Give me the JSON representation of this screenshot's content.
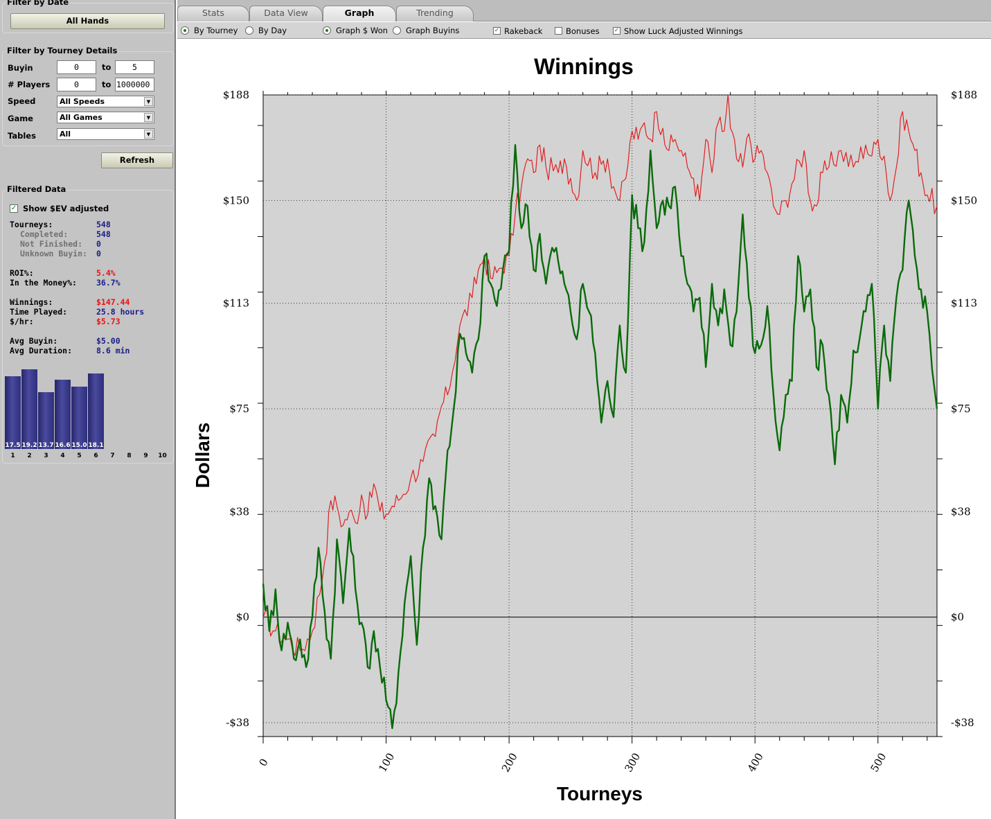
{
  "sidebar": {
    "filter_by_date": {
      "title": "Filter by Date",
      "all_hands": "All Hands"
    },
    "filter_tourney": {
      "title": "Filter by Tourney Details",
      "buyin_label": "Buyin",
      "buyin_from": "0",
      "buyin_to": "5",
      "players_label": "# Players",
      "players_from": "0",
      "players_to": "1000000",
      "to": "to",
      "speed_label": "Speed",
      "speed_value": "All Speeds",
      "game_label": "Game",
      "game_value": "All Games",
      "tables_label": "Tables",
      "tables_value": "All",
      "refresh": "Refresh"
    },
    "filtered": {
      "title": "Filtered Data",
      "show_ev": "Show $EV adjusted",
      "tourneys_label": "Tourneys:",
      "tourneys": "548",
      "completed_label": "Completed:",
      "completed": "548",
      "not_finished_label": "Not Finished:",
      "not_finished": "0",
      "unknown_label": "Unknown Buyin:",
      "unknown": "0",
      "roi_label": "ROI%:",
      "roi": "5.4%",
      "itm_label": "In the Money%:",
      "itm": "36.7%",
      "winnings_label": "Winnings:",
      "winnings": "$147.44",
      "time_label": "Time Played:",
      "time": "25.8 hours",
      "hr_label": "$/hr:",
      "hr": "$5.73",
      "avg_buyin_label": "Avg Buyin:",
      "avg_buyin": "$5.00",
      "avg_dur_label": "Avg Duration:",
      "avg_dur": "8.6 min"
    },
    "histogram": {
      "positions": [
        "1",
        "2",
        "3",
        "4",
        "5",
        "6",
        "7",
        "8",
        "9",
        "10"
      ],
      "values": [
        17.5,
        19.2,
        13.7,
        16.6,
        15.0,
        18.1,
        null,
        null,
        null,
        null
      ],
      "labels": [
        "17.5",
        "19.2",
        "13.7",
        "16.6",
        "15.0",
        "18.1",
        "",
        "",
        "",
        ""
      ]
    }
  },
  "tabs": [
    {
      "label": "Stats",
      "active": false
    },
    {
      "label": "Data View",
      "active": false
    },
    {
      "label": "Graph",
      "active": true
    },
    {
      "label": "Trending",
      "active": false
    }
  ],
  "options": {
    "by_tourney": "By Tourney",
    "by_day": "By Day",
    "graph_won": "Graph $ Won",
    "graph_buyins": "Graph Buyins",
    "rakeback": "Rakeback",
    "bonuses": "Bonuses",
    "luck": "Show Luck Adjusted Winnings"
  },
  "colors": {
    "red_series": "#e02020",
    "green_series": "#0a6a0a",
    "plot_bg": "#d3d3d3"
  },
  "chart_data": {
    "type": "line",
    "title": "Winnings",
    "xlabel": "Tourneys",
    "ylabel": "Dollars",
    "xlim": [
      0,
      548
    ],
    "ylim": [
      -43,
      188
    ],
    "yticks": [
      188,
      150,
      113,
      75,
      38,
      0,
      -38
    ],
    "ytick_labels": [
      "$188",
      "$150",
      "$113",
      "$75",
      "$38",
      "$0",
      "-$38"
    ],
    "xticks": [
      0,
      100,
      200,
      300,
      400,
      500
    ],
    "series": [
      {
        "color": "#e02020",
        "x": [
          0,
          10,
          20,
          30,
          40,
          50,
          55,
          60,
          65,
          70,
          75,
          80,
          85,
          90,
          95,
          100,
          105,
          110,
          120,
          130,
          140,
          145,
          150,
          160,
          170,
          175,
          180,
          185,
          190,
          200,
          205,
          210,
          215,
          220,
          225,
          230,
          240,
          245,
          250,
          255,
          260,
          270,
          275,
          280,
          285,
          290,
          295,
          300,
          305,
          310,
          315,
          320,
          325,
          330,
          335,
          340,
          345,
          350,
          355,
          360,
          365,
          370,
          375,
          378,
          380,
          385,
          390,
          395,
          400,
          405,
          410,
          415,
          420,
          425,
          430,
          440,
          445,
          450,
          455,
          460,
          470,
          480,
          490,
          495,
          500,
          505,
          510,
          515,
          520,
          525,
          530,
          535,
          540,
          548
        ],
        "y": [
          0,
          -5,
          -8,
          -12,
          -5,
          20,
          42,
          40,
          33,
          38,
          34,
          44,
          37,
          48,
          38,
          37,
          40,
          42,
          50,
          56,
          65,
          76,
          80,
          105,
          115,
          125,
          130,
          122,
          124,
          130,
          145,
          155,
          165,
          160,
          170,
          162,
          160,
          165,
          158,
          150,
          168,
          160,
          163,
          165,
          155,
          150,
          158,
          175,
          172,
          178,
          172,
          182,
          176,
          168,
          172,
          168,
          162,
          158,
          150,
          172,
          160,
          178,
          175,
          188,
          176,
          165,
          162,
          174,
          165,
          168,
          160,
          148,
          145,
          150,
          156,
          168,
          150,
          148,
          160,
          162,
          168,
          162,
          170,
          166,
          172,
          166,
          150,
          162,
          182,
          175,
          168,
          160,
          152,
          148
        ]
      },
      {
        "color": "#0a6a0a",
        "x": [
          0,
          5,
          10,
          15,
          20,
          25,
          30,
          35,
          40,
          45,
          50,
          55,
          60,
          65,
          70,
          75,
          80,
          85,
          90,
          95,
          100,
          105,
          110,
          115,
          120,
          125,
          130,
          135,
          140,
          145,
          150,
          155,
          160,
          165,
          170,
          175,
          180,
          185,
          190,
          195,
          200,
          205,
          210,
          215,
          220,
          225,
          230,
          235,
          240,
          245,
          250,
          255,
          260,
          265,
          270,
          275,
          280,
          285,
          290,
          295,
          300,
          305,
          310,
          315,
          320,
          325,
          330,
          335,
          340,
          345,
          350,
          355,
          360,
          365,
          370,
          375,
          380,
          385,
          390,
          395,
          400,
          405,
          410,
          415,
          420,
          425,
          430,
          435,
          440,
          445,
          450,
          455,
          460,
          465,
          470,
          475,
          480,
          485,
          490,
          495,
          500,
          505,
          510,
          515,
          520,
          525,
          530,
          535,
          540,
          548
        ],
        "y": [
          12,
          -5,
          10,
          -12,
          -2,
          -15,
          -8,
          -18,
          0,
          25,
          2,
          -15,
          28,
          5,
          32,
          10,
          -2,
          -18,
          -5,
          -18,
          -30,
          -40,
          -20,
          5,
          22,
          -10,
          25,
          50,
          40,
          28,
          60,
          75,
          102,
          95,
          88,
          100,
          130,
          120,
          112,
          125,
          132,
          170,
          140,
          148,
          125,
          138,
          120,
          133,
          128,
          120,
          110,
          100,
          120,
          110,
          95,
          70,
          85,
          72,
          105,
          88,
          152,
          140,
          135,
          168,
          140,
          150,
          148,
          155,
          130,
          120,
          110,
          115,
          90,
          120,
          105,
          118,
          98,
          110,
          145,
          115,
          95,
          98,
          112,
          80,
          60,
          80,
          85,
          130,
          110,
          118,
          90,
          98,
          80,
          55,
          80,
          70,
          96,
          100,
          110,
          120,
          75,
          105,
          85,
          115,
          125,
          150,
          130,
          118,
          110,
          75
        ]
      }
    ]
  }
}
